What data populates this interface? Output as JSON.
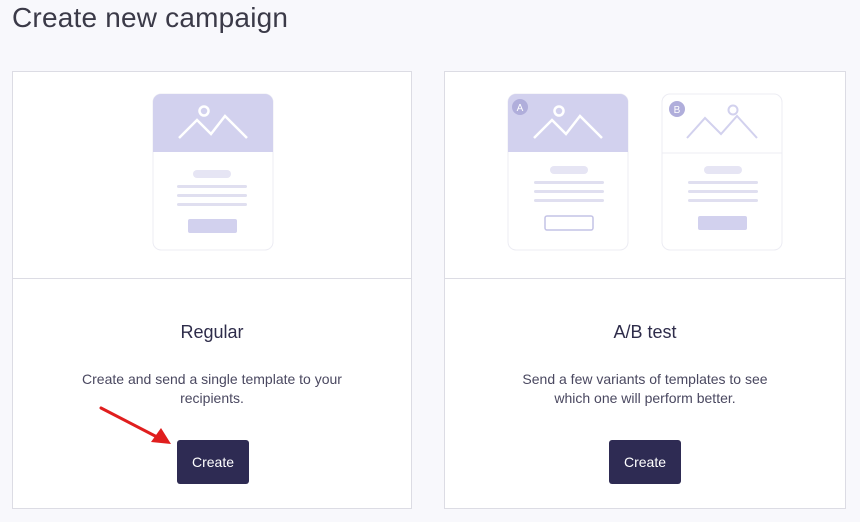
{
  "page": {
    "title": "Create new campaign"
  },
  "colors": {
    "accent_light": "#d2d1ee",
    "button_bg": "#2e2b53",
    "arrow": "#e01e1e"
  },
  "cards": [
    {
      "id": "regular",
      "title": "Regular",
      "description": "Create and send a single template to your recipients.",
      "button_label": "Create"
    },
    {
      "id": "ab",
      "title": "A/B test",
      "description": "Send a few variants of templates to see which one will perform better.",
      "button_label": "Create",
      "variant_labels": [
        "A",
        "B"
      ]
    }
  ]
}
